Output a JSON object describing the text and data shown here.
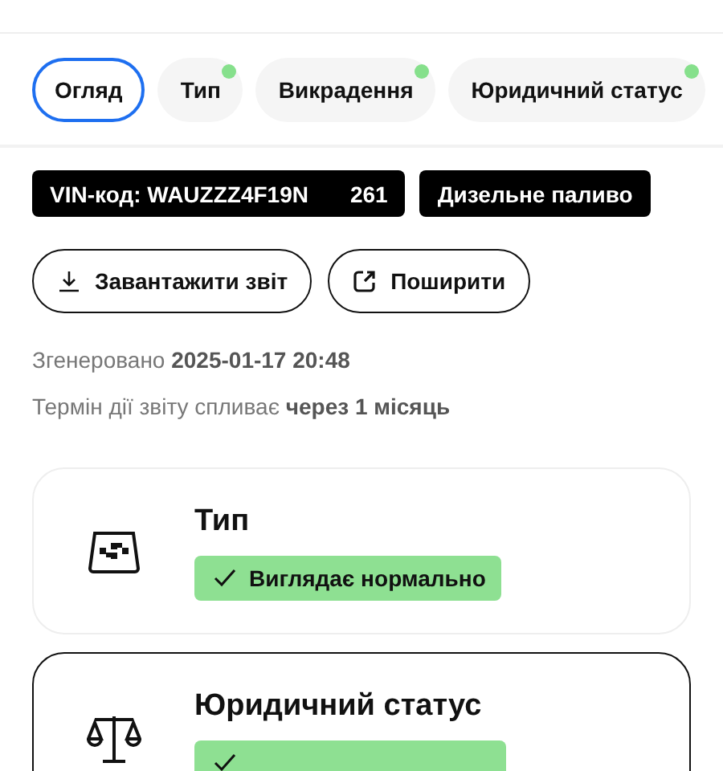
{
  "tabs": [
    {
      "label": "Огляд",
      "selected": true,
      "dot": false
    },
    {
      "label": "Тип",
      "selected": false,
      "dot": true
    },
    {
      "label": "Викрадення",
      "selected": false,
      "dot": true
    },
    {
      "label": "Юридичний статус",
      "selected": false,
      "dot": true
    }
  ],
  "chips": [
    {
      "label": "VIN-код: WAUZZZ4F19N",
      "suffix": "261"
    },
    {
      "label": "Дизельне паливо"
    }
  ],
  "buttons": [
    {
      "label": "Завантажити звіт",
      "kind": "download"
    },
    {
      "label": "Поширити",
      "kind": "share"
    }
  ],
  "info": [
    "Згенеровано **2025-01-17 20:48**",
    "Термін дії звіту спливає **через 1 місяць**"
  ],
  "cards": [
    {
      "title": "Тип",
      "kind": "taxi",
      "status": "Виглядає нормально",
      "selected": false
    },
    {
      "title": "Юридичний статус",
      "kind": "scales",
      "selected": true
    }
  ]
}
